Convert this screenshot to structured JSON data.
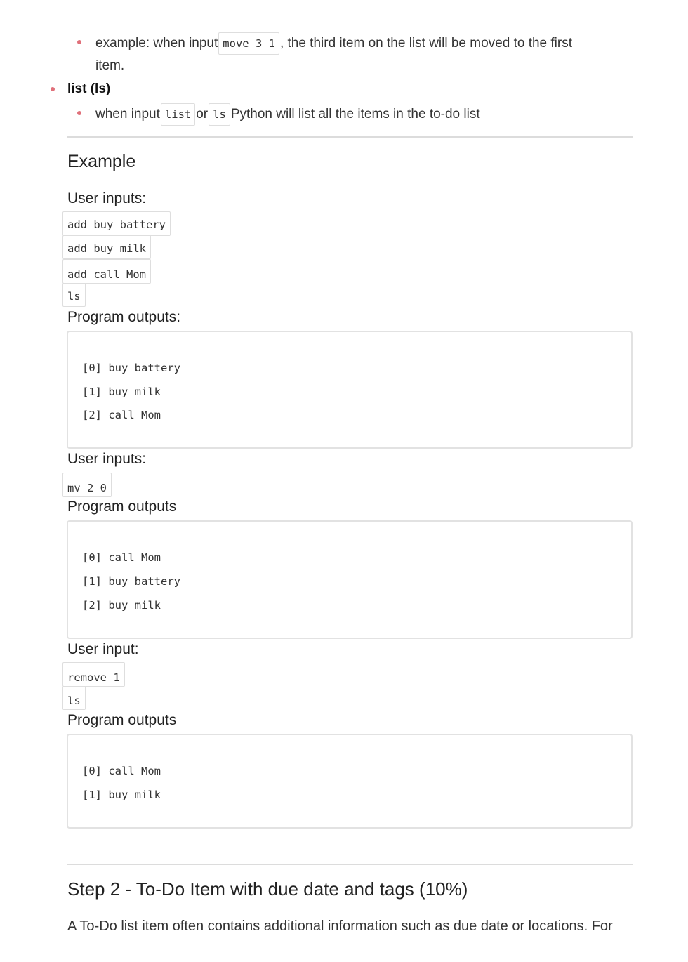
{
  "move_section": {
    "example_prefix": "example: when input",
    "example_code": "move 3 1",
    "example_suffix": ", the third item on the list will be moved to the first",
    "example_continuation": "item."
  },
  "list_section": {
    "title": "list (ls)",
    "desc_prefix": "when input",
    "code_list": "list",
    "or_text": "or",
    "code_ls": "ls",
    "desc_suffix": "Python will list all the items in the to-do list"
  },
  "example": {
    "heading": "Example",
    "blocks": [
      {
        "input_label": "User inputs:",
        "inputs": [
          "add buy battery",
          "add buy milk",
          "add call Mom",
          "ls"
        ],
        "output_label": "Program outputs:",
        "outputs": [
          "[0] buy battery",
          "[1] buy milk",
          "[2] call Mom"
        ]
      },
      {
        "input_label": "User inputs:",
        "inputs": [
          "mv 2 0"
        ],
        "output_label": "Program outputs",
        "outputs": [
          "[0] call Mom",
          "[1] buy battery",
          "[2] buy milk"
        ]
      },
      {
        "input_label": "User input:",
        "inputs": [
          "remove 1",
          "ls"
        ],
        "output_label": "Program outputs",
        "outputs": [
          "[0] call Mom",
          "[1] buy milk"
        ]
      }
    ]
  },
  "step2": {
    "heading": "Step 2 - To-Do Item with due date and tags (10%)",
    "paragraph": "A To-Do list item often contains additional information such as due date or locations. For"
  }
}
